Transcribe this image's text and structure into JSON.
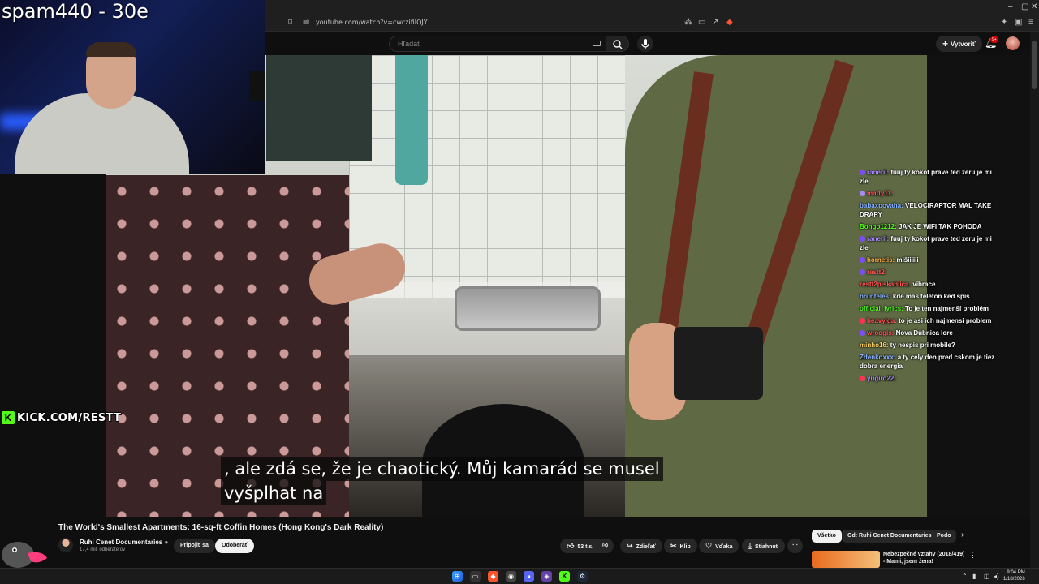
{
  "browser": {
    "url": "youtube.com/watch?v=cwczifiIQJY",
    "window_controls": [
      "–",
      "▢",
      "✕"
    ]
  },
  "youtube_header": {
    "search_placeholder": "Hľadať",
    "create_label": "Vytvoriť",
    "notification_count": "9+"
  },
  "overlay": {
    "streamer_title": "spam440 - 30e",
    "kick_text": "KICK.COM/RESTT",
    "kick_logo": "K"
  },
  "video": {
    "subtitle_line1": ", ale zdá se, že je chaotický.  Můj kamarád se musel",
    "subtitle_line2": "vyšplhat na"
  },
  "chat": [
    {
      "user": "raneril:",
      "text": "fuuj ty kokot prave ted zeru je mi zle",
      "color": "#a78bfa",
      "badge": "#7c4dff"
    },
    {
      "user": "matty11:",
      "text": "",
      "color": "#ff5555",
      "badge": "#a78bfa"
    },
    {
      "user": "babaxpovaha:",
      "text": "VELOCIRAPTOR MAL TAKE DRAPY",
      "color": "#8ab4ff",
      "badge": ""
    },
    {
      "user": "Bongo1212:",
      "text": "JAK  JE WIFI TAK POHODA",
      "color": "#53fc18",
      "badge": ""
    },
    {
      "user": "raneril:",
      "text": "fuuj ty kokot prave ted zeru je mi zle",
      "color": "#a78bfa",
      "badge": "#7c4dff"
    },
    {
      "user": "hornetis:",
      "text": "mišiiiiii",
      "color": "#ffb347",
      "badge": "#7c4dff"
    },
    {
      "user": "restt2:",
      "text": "",
      "color": "#ff5555",
      "badge": "#7c4dff"
    },
    {
      "user": "restt2piskahlica:",
      "text": "vibrace",
      "color": "#ff5555",
      "badge": ""
    },
    {
      "user": "brunteles:",
      "text": "kde mas telefon ked spis",
      "color": "#8ab4ff",
      "badge": ""
    },
    {
      "user": "official_lyrics:",
      "text": "To je ten najmenší problém",
      "color": "#53fc18",
      "badge": ""
    },
    {
      "user": "heavyjga:",
      "text": "to je asi ich najmensi problem",
      "color": "#ff5555",
      "badge": "#ff3355"
    },
    {
      "user": "wroogis:",
      "text": "Nova Dubnica lore",
      "color": "#ff5555",
      "badge": "#7c4dff"
    },
    {
      "user": "minho16:",
      "text": "ty nespis pri mobile?",
      "color": "#ffd166",
      "badge": ""
    },
    {
      "user": "Zdenkoxxx:",
      "text": "a ty cely den pred cskom je tiez dobra energia",
      "color": "#8ab4ff",
      "badge": ""
    },
    {
      "user": "yugiro22:",
      "text": "",
      "color": "#a78bfa",
      "badge": "#ff3355"
    }
  ],
  "video_info": {
    "title": "The World's Smallest Apartments: 16-sq-ft Coffin Homes (Hong Kong's Dark Reality)",
    "channel": "Ruhi Cenet Documentaries",
    "subscribers": "17,4 mil. odberateľov",
    "join_label": "Pripojiť sa",
    "subscribe_label": "Odoberať",
    "likes": "53 tis.",
    "share_label": "Zdieľať",
    "clip_label": "Klip",
    "thanks_label": "Vďaka",
    "download_label": "Stiahnuť",
    "more_label": "⋯"
  },
  "recommendations": {
    "chips": [
      "Všetko",
      "Od: Ruhi Cenet Documentaries",
      "Podo"
    ],
    "first_title_line1": "Nebezpečné vztahy (2018/419)",
    "first_title_line2": "- Mami, jsem žena!"
  },
  "taskbar": {
    "time": "9:04 PM",
    "date": "1/18/2026"
  }
}
